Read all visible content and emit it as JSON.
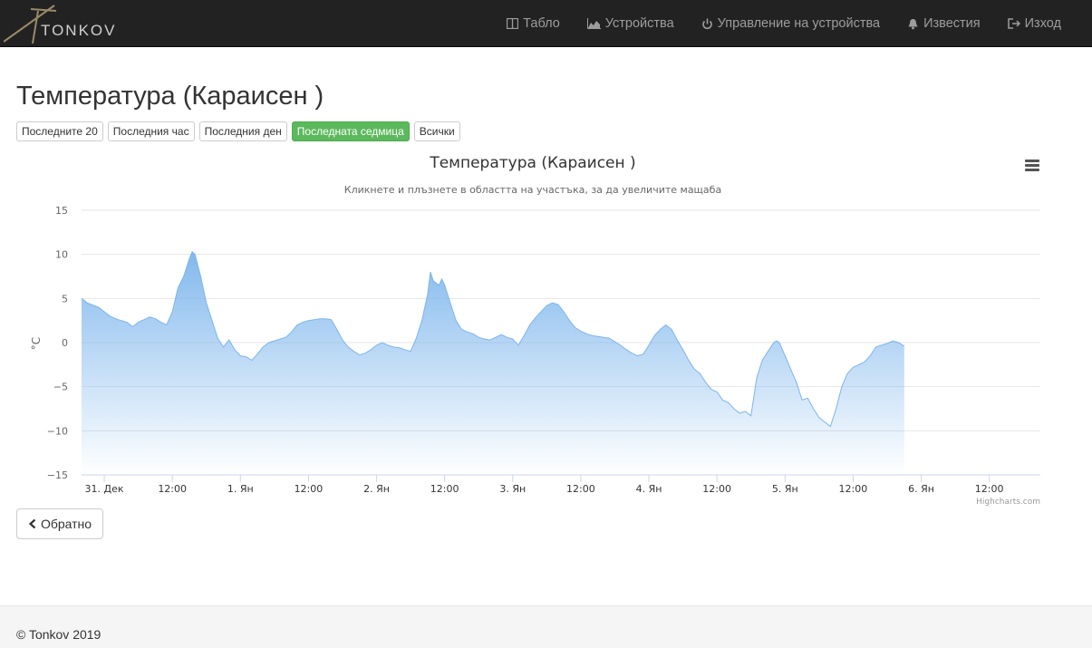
{
  "brand": {
    "name": "TONKOV"
  },
  "nav": {
    "items": [
      {
        "label": "Табло",
        "icon": "columns-icon"
      },
      {
        "label": "Устройства",
        "icon": "area-chart-icon"
      },
      {
        "label": "Управление на устройства",
        "icon": "power-icon"
      },
      {
        "label": "Известия",
        "icon": "bell-icon"
      },
      {
        "label": "Изход",
        "icon": "logout-icon"
      }
    ]
  },
  "page": {
    "title": "Температура (Караисен )"
  },
  "range_buttons": [
    {
      "label": "Последните 20",
      "active": false
    },
    {
      "label": "Последния час",
      "active": false
    },
    {
      "label": "Последния ден",
      "active": false
    },
    {
      "label": "Последната седмица",
      "active": true
    },
    {
      "label": "Всички",
      "active": false
    }
  ],
  "chart_data": {
    "type": "area",
    "title": "Температура (Караисен )",
    "subtitle": "Кликнете и плъзнете в областта на участъка, за да увеличите мащаба",
    "ylabel": "°C",
    "ylim": [
      -15,
      15
    ],
    "y_ticks": [
      "15",
      "10",
      "5",
      "0",
      "−5",
      "−10",
      "−15"
    ],
    "x_ticks": [
      "31. Дек",
      "12:00",
      "1. Ян",
      "12:00",
      "2. Ян",
      "12:00",
      "3. Ян",
      "12:00",
      "4. Ян",
      "12:00",
      "5. Ян",
      "12:00",
      "6. Ян",
      "12:00"
    ],
    "x_tick_hours": [
      0,
      12,
      24,
      36,
      48,
      60,
      72,
      84,
      96,
      108,
      120,
      132,
      144,
      156
    ],
    "xlim_hours": [
      -4,
      165
    ],
    "series": [
      {
        "color": "#7cb5ec",
        "points": [
          [
            -4,
            5.0
          ],
          [
            -3,
            4.5
          ],
          [
            -1,
            4.0
          ],
          [
            0,
            3.5
          ],
          [
            1,
            3.0
          ],
          [
            2,
            2.7
          ],
          [
            3,
            2.5
          ],
          [
            4,
            2.3
          ],
          [
            5,
            1.8
          ],
          [
            6,
            2.3
          ],
          [
            7,
            2.6
          ],
          [
            8,
            2.9
          ],
          [
            9,
            2.7
          ],
          [
            10,
            2.3
          ],
          [
            11,
            2.0
          ],
          [
            12,
            3.5
          ],
          [
            13,
            6.2
          ],
          [
            14,
            7.5
          ],
          [
            15,
            9.5
          ],
          [
            15.5,
            10.3
          ],
          [
            16,
            10.0
          ],
          [
            17,
            7.5
          ],
          [
            18,
            4.5
          ],
          [
            19,
            2.5
          ],
          [
            20,
            0.5
          ],
          [
            21,
            -0.5
          ],
          [
            22,
            0.3
          ],
          [
            23,
            -0.8
          ],
          [
            24,
            -1.5
          ],
          [
            25,
            -1.6
          ],
          [
            26,
            -2.0
          ],
          [
            27,
            -1.3
          ],
          [
            28,
            -0.5
          ],
          [
            29,
            0.0
          ],
          [
            30,
            0.2
          ],
          [
            31,
            0.4
          ],
          [
            32,
            0.6
          ],
          [
            33,
            1.2
          ],
          [
            34,
            2.0
          ],
          [
            35,
            2.3
          ],
          [
            36,
            2.5
          ],
          [
            37,
            2.6
          ],
          [
            38,
            2.7
          ],
          [
            39,
            2.7
          ],
          [
            40,
            2.6
          ],
          [
            41,
            1.5
          ],
          [
            42,
            0.3
          ],
          [
            43,
            -0.5
          ],
          [
            44,
            -1.0
          ],
          [
            45,
            -1.4
          ],
          [
            46,
            -1.2
          ],
          [
            47,
            -0.8
          ],
          [
            48,
            -0.3
          ],
          [
            49,
            0.0
          ],
          [
            50,
            -0.3
          ],
          [
            51,
            -0.5
          ],
          [
            52,
            -0.6
          ],
          [
            53,
            -0.8
          ],
          [
            54,
            -1.0
          ],
          [
            55,
            0.5
          ],
          [
            56,
            2.5
          ],
          [
            57,
            5.5
          ],
          [
            57.5,
            8.0
          ],
          [
            58,
            7.0
          ],
          [
            59,
            6.5
          ],
          [
            59.5,
            7.2
          ],
          [
            60,
            6.5
          ],
          [
            61,
            4.5
          ],
          [
            62,
            2.5
          ],
          [
            63,
            1.5
          ],
          [
            64,
            1.2
          ],
          [
            65,
            1.0
          ],
          [
            66,
            0.6
          ],
          [
            67,
            0.4
          ],
          [
            68,
            0.3
          ],
          [
            69,
            0.6
          ],
          [
            70,
            0.9
          ],
          [
            71,
            0.6
          ],
          [
            72,
            0.4
          ],
          [
            73,
            -0.3
          ],
          [
            74,
            0.8
          ],
          [
            75,
            2.0
          ],
          [
            76,
            2.8
          ],
          [
            77,
            3.5
          ],
          [
            78,
            4.2
          ],
          [
            79,
            4.5
          ],
          [
            80,
            4.3
          ],
          [
            81,
            3.5
          ],
          [
            82,
            2.5
          ],
          [
            83,
            1.7
          ],
          [
            84,
            1.3
          ],
          [
            85,
            1.0
          ],
          [
            86,
            0.8
          ],
          [
            87,
            0.7
          ],
          [
            88,
            0.6
          ],
          [
            89,
            0.5
          ],
          [
            90,
            0.1
          ],
          [
            91,
            -0.3
          ],
          [
            92,
            -0.8
          ],
          [
            93,
            -1.2
          ],
          [
            94,
            -1.5
          ],
          [
            95,
            -1.3
          ],
          [
            96,
            -0.3
          ],
          [
            97,
            0.8
          ],
          [
            98,
            1.5
          ],
          [
            99,
            2.0
          ],
          [
            100,
            1.5
          ],
          [
            101,
            0.3
          ],
          [
            102,
            -0.8
          ],
          [
            103,
            -2.0
          ],
          [
            104,
            -3.0
          ],
          [
            105,
            -3.5
          ],
          [
            106,
            -4.5
          ],
          [
            107,
            -5.3
          ],
          [
            108,
            -5.6
          ],
          [
            109,
            -6.5
          ],
          [
            110,
            -6.8
          ],
          [
            111,
            -7.5
          ],
          [
            112,
            -8.0
          ],
          [
            113,
            -7.8
          ],
          [
            114,
            -8.3
          ],
          [
            115,
            -4.0
          ],
          [
            116,
            -2.0
          ],
          [
            117,
            -1.0
          ],
          [
            118,
            0.0
          ],
          [
            118.5,
            0.2
          ],
          [
            119,
            0.0
          ],
          [
            120,
            -1.5
          ],
          [
            121,
            -3.0
          ],
          [
            122,
            -4.5
          ],
          [
            123,
            -6.5
          ],
          [
            124,
            -6.3
          ],
          [
            125,
            -7.5
          ],
          [
            126,
            -8.5
          ],
          [
            127,
            -9.0
          ],
          [
            128,
            -9.5
          ],
          [
            129,
            -7.5
          ],
          [
            130,
            -5.0
          ],
          [
            131,
            -3.5
          ],
          [
            132,
            -2.8
          ],
          [
            133,
            -2.5
          ],
          [
            134,
            -2.2
          ],
          [
            135,
            -1.5
          ],
          [
            136,
            -0.5
          ],
          [
            137,
            -0.3
          ],
          [
            138,
            -0.1
          ],
          [
            139,
            0.2
          ],
          [
            140,
            0.0
          ],
          [
            141,
            -0.4
          ]
        ]
      }
    ],
    "credits": "Highcharts.com"
  },
  "buttons": {
    "back_label": "Обратно"
  },
  "footer": {
    "text": "© Tonkov 2019"
  }
}
